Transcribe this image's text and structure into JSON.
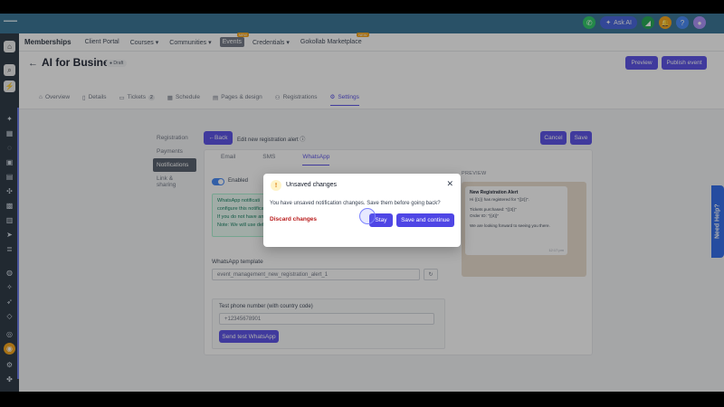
{
  "topbar": {
    "ask_ai": "Ask AI"
  },
  "nav": {
    "brand": "Memberships",
    "items": [
      "Client Portal",
      "Courses",
      "Communities",
      "Events",
      "Credentials",
      "Gokollab Marketplace"
    ],
    "new_badge": "NEW"
  },
  "page": {
    "back_icon": "arrow-left-icon",
    "title": "AI for Business",
    "status": "Draft",
    "preview_btn": "Preview",
    "publish_btn": "Publish event",
    "tabs": [
      {
        "label": "Overview"
      },
      {
        "label": "Details"
      },
      {
        "label": "Tickets",
        "count": "2"
      },
      {
        "label": "Schedule"
      },
      {
        "label": "Pages & design"
      },
      {
        "label": "Registrations"
      },
      {
        "label": "Settings",
        "active": true
      }
    ]
  },
  "settings": {
    "left_nav": [
      "Registration",
      "Payments",
      "Notifications",
      "Link & sharing"
    ],
    "back_btn": "Back",
    "edit_title": "Edit new registration alert",
    "cancel_btn": "Cancel",
    "save_btn": "Save",
    "channel_tabs": [
      "Email",
      "SMS",
      "WhatsApp"
    ],
    "enabled_label": "Enabled",
    "info_lines": [
      "WhatsApp notificati",
      "configure this notifica",
      "If you do not have any",
      "Note: We will use defau"
    ],
    "template_label": "WhatsApp template",
    "template_value": "event_management_new_registration_alert_1",
    "test_label": "Test phone number (with country code)",
    "test_placeholder": "+12345678901",
    "send_test_btn": "Send test WhatsApp"
  },
  "preview": {
    "label": "PREVIEW",
    "title": "New Registration Alert",
    "line1": "Hi {{1}} has registered for \"{{2}}\".",
    "line2": "Tickets purchased: \"{{3}}\"",
    "line3": "Order ID: \"{{4}}\"",
    "line4": "We are looking forward to seeing you there.",
    "time": "12:17 pm"
  },
  "modal": {
    "title": "Unsaved changes",
    "body": "You have unsaved notification changes. Save them before going back?",
    "discard": "Discard changes",
    "stay": "Stay",
    "save_continue": "Save and continue"
  },
  "help": "Need Help?",
  "colors": {
    "primary": "#4f46e5",
    "danger": "#b91c1c",
    "success_bg": "#ecfdf5"
  }
}
